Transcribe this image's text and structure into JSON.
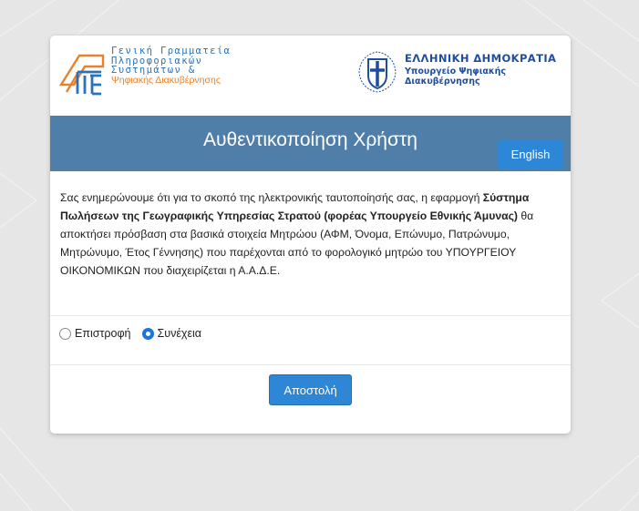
{
  "gsis": {
    "line1": "Γενική Γραμματεία",
    "line2": "Πληροφοριακών",
    "line3": "Συστημάτων &",
    "line4": "Ψηφιακής Διακυβέρνησης"
  },
  "government": {
    "title": "ΕΛΛΗΝΙΚΗ ΔΗΜΟΚΡΑΤΙΑ",
    "ministry_line1": "Υπουργείο Ψηφιακής",
    "ministry_line2": "Διακυβέρνησης"
  },
  "header": {
    "title": "Αυθεντικοποίηση Χρήστη",
    "language_button": "English"
  },
  "notice": {
    "part1": "Σας ενημερώνουμε ότι για το σκοπό της ηλεκτρονικής ταυτοποίησής σας, η εφαρμογή ",
    "app_name": "Σύστημα Πωλήσεων της Γεωγραφικής Υπηρεσίας Στρατού (φορέας Υπουργείο Εθνικής Άμυνας)",
    "part2": " θα αποκτήσει πρόσβαση στα βασικά στοιχεία Μητρώου (ΑΦΜ, Όνομα, Επώνυμο, Πατρώνυμο, Μητρώνυμο, Έτος Γέννησης) που παρέχονται από το φορολογικό μητρώο του ΥΠΟΥΡΓΕΙΟΥ ΟΙΚΟΝΟΜΙΚΩΝ που διαχειρίζεται η Α.Α.Δ.Ε."
  },
  "options": {
    "back_label": "Επιστροφή",
    "continue_label": "Συνέχεια",
    "selected": "continue"
  },
  "submit_label": "Αποστολή",
  "colors": {
    "header_band": "#4f7ea9",
    "primary_button": "#2e86d6",
    "gsis_blue": "#2a72b8",
    "gsis_orange": "#e8812c",
    "government_blue": "#1f4e9c"
  }
}
